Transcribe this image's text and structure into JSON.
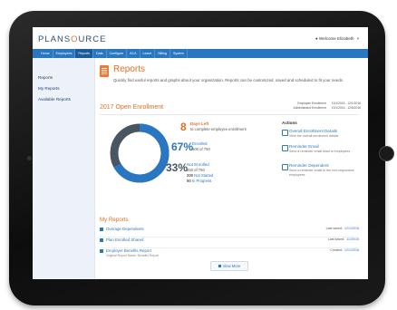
{
  "app": {
    "brand_prefix": "PLANS",
    "brand_o": "O",
    "brand_suffix": "URCE",
    "welcome": "Welcome Elizabeth"
  },
  "nav": [
    "Home",
    "Employees",
    "Reports",
    "Data",
    "Configure",
    "ACA",
    "Leave",
    "Billing",
    "System"
  ],
  "sidebar": [
    "Reports",
    "My Reports",
    "Available Reports"
  ],
  "header": {
    "title": "Reports",
    "subtitle": "Quickly find useful reports and graphs about your organization. Reports can be customized, saved and scheduled to fit your needs."
  },
  "enrollment": {
    "title": "2017 Open Enrollment",
    "dates": [
      {
        "label": "Employee Enrollment",
        "value": "10/1/2016 - 12/1/2016"
      },
      {
        "label": "Administrator Enrollment",
        "value": "10/1/2016 - 12/8/2016"
      }
    ],
    "days_left_num": "8",
    "days_left": "Days Left",
    "days_left_desc": "to complete employee enrollment",
    "enrolled_pct": "67%",
    "enrolled_label": "Enrolled",
    "enrolled_detail": "500 of 750",
    "not_enrolled_pct": "33%",
    "not_enrolled_label": "Not Enrolled",
    "not_enrolled_detail": "250 of 750",
    "not_started_num": "200",
    "not_started": "Not Started",
    "in_progress_num": "50",
    "in_progress": "In Progress",
    "enrolled_fraction": 0.67,
    "colors": {
      "enrolled": "#2a77c1",
      "not_enrolled": "#4a5562",
      "accent": "#e06f24"
    }
  },
  "actions": {
    "title": "Actions",
    "items": [
      {
        "label": "Overall Enrollment Details",
        "desc": "View the overall enrollment details"
      },
      {
        "label": "Reminder Email",
        "desc": "Send a reminder email blast to employees"
      },
      {
        "label": "Reminder Dependent",
        "desc": "Send a reminder email to the non-responsive employees"
      }
    ]
  },
  "my_reports": {
    "title": "My Reports",
    "rows": [
      {
        "name": "Overage Dependents",
        "sub": "",
        "meta_label": "Last saved:",
        "meta_date": "12/1/2016"
      },
      {
        "name": "Plan Enrolled Shared",
        "sub": "",
        "meta_label": "Last saved:",
        "meta_date": "11/20/16"
      },
      {
        "name": "Employer Benefits Report",
        "sub": "Original Report Name: Benefits Report",
        "meta_label": "Created:",
        "meta_date": "12/1/2016"
      }
    ],
    "view_more": "View More"
  }
}
